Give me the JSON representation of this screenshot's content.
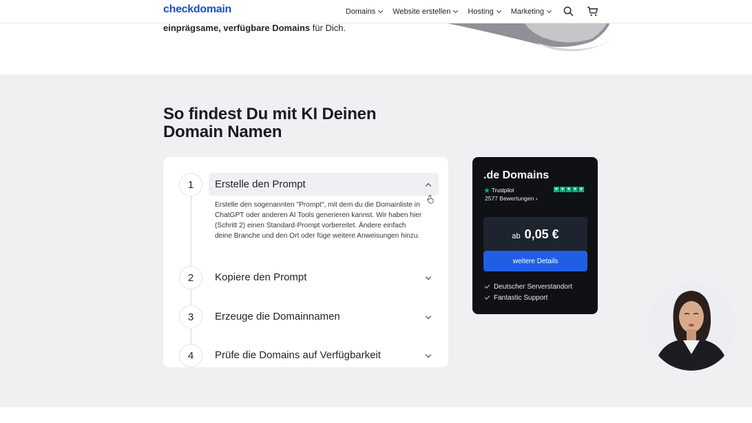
{
  "header": {
    "logo": "checkdomain",
    "nav": [
      {
        "label": "Domains"
      },
      {
        "label": "Website erstellen"
      },
      {
        "label": "Hosting"
      },
      {
        "label": "Marketing"
      }
    ],
    "icons": [
      "search-icon",
      "cart-icon"
    ]
  },
  "hero": {
    "text_bold": "einprägsame, verfügbare Domains",
    "text_rest": " für Dich."
  },
  "section": {
    "headline": "So findest Du mit KI Deinen Domain Namen",
    "steps": [
      {
        "num": "1",
        "title": "Erstelle den Prompt",
        "expanded": true,
        "body": "Erstelle den sogenannten \"Prompt\", mit dem du die Domainliste in ChatGPT oder anderen AI Tools generieren kannst. Wir haben hier (Schritt 2) einen Standard-Prompt vorbereitet. Ändere einfach deine Branche und den Ort oder füge weitere Anweisungen hinzu."
      },
      {
        "num": "2",
        "title": "Kopiere den Prompt",
        "expanded": false
      },
      {
        "num": "3",
        "title": "Erzeuge die Domainnamen",
        "expanded": false
      },
      {
        "num": "4",
        "title": "Prüfe die Domains auf Verfügbarkeit",
        "expanded": false
      }
    ]
  },
  "pricing": {
    "title": ".de Domains",
    "trustpilot": "Trustpilot",
    "reviews": "2577 Bewertungen",
    "price_prefix": "ab",
    "price": "0,05 €",
    "button": "weitere Details",
    "features": [
      "Deutscher Serverstandort",
      "Fantastic Support"
    ]
  },
  "colors": {
    "accent": "#1f5fe6",
    "dark_card": "#0f1115",
    "section_bg": "#eff0f2",
    "trustpilot_green": "#00b67a"
  }
}
